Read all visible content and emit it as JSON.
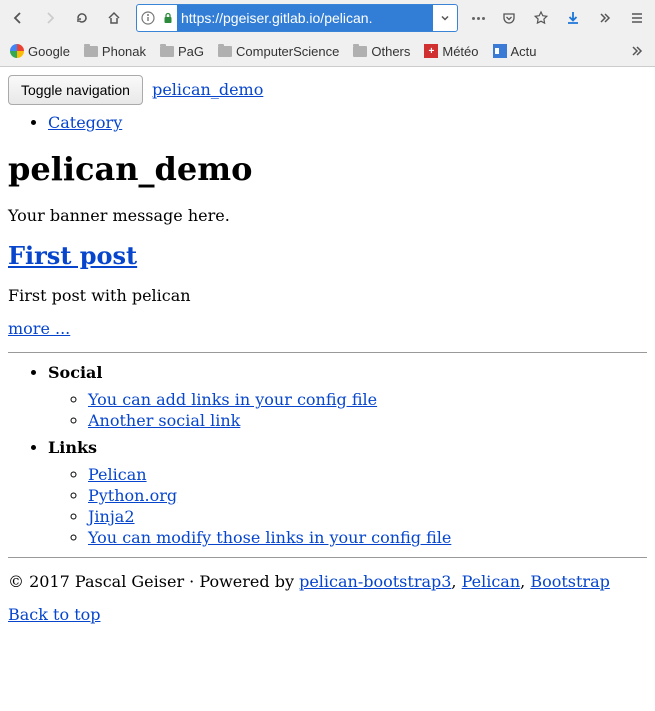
{
  "browser": {
    "url": "https://pgeiser.gitlab.io/pelican.",
    "bookmarks": [
      {
        "label": "Google",
        "type": "google"
      },
      {
        "label": "Phonak",
        "type": "folder"
      },
      {
        "label": "PaG",
        "type": "folder"
      },
      {
        "label": "ComputerScience",
        "type": "folder"
      },
      {
        "label": "Others",
        "type": "folder"
      },
      {
        "label": "Météo",
        "type": "meteo"
      },
      {
        "label": "Actu",
        "type": "actu"
      }
    ]
  },
  "nav": {
    "toggle_label": "Toggle navigation",
    "brand": "pelican_demo",
    "menu": [
      "Category"
    ]
  },
  "page": {
    "title": "pelican_demo",
    "banner": "Your banner message here.",
    "post_title": "First post",
    "post_excerpt": "First post with pelican",
    "more": "more ..."
  },
  "sidebar": {
    "social_heading": "Social",
    "social_links": [
      "You can add links in your config file",
      "Another social link"
    ],
    "links_heading": "Links",
    "links": [
      "Pelican",
      "Python.org",
      "Jinja2",
      "You can modify those links in your config file"
    ]
  },
  "footer": {
    "copyright": "© 2017 Pascal Geiser · Powered by ",
    "credits": [
      "pelican-bootstrap3",
      "Pelican",
      "Bootstrap"
    ],
    "back_to_top": "Back to top"
  }
}
